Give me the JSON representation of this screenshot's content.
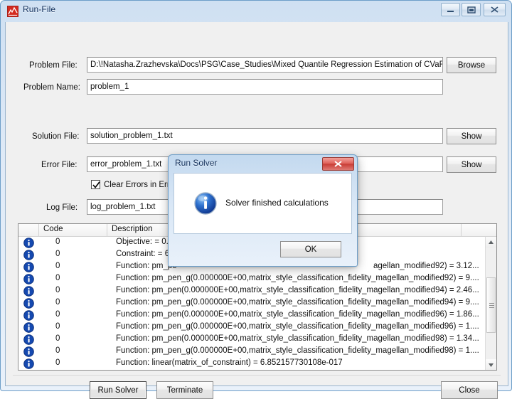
{
  "window": {
    "title": "Run-File",
    "icon": "chart-app-icon",
    "controls": {
      "minimize": "minimize-icon",
      "maximize": "maximize-icon",
      "close": "close-icon"
    }
  },
  "form": {
    "problem_file": {
      "label": "Problem File:",
      "value": "D:\\!Natasha.Zrazhevska\\Docs\\PSG\\Case_Studies\\Mixed Quantile Regression Estimation of CVaR with",
      "button": "Browse"
    },
    "problem_name": {
      "label": "Problem Name:",
      "value": "problem_1"
    },
    "solution_file": {
      "label": "Solution File:",
      "value": "solution_problem_1.txt",
      "button": "Show"
    },
    "error_file": {
      "label": "Error File:",
      "value": "error_problem_1.txt",
      "button": "Show"
    },
    "clear_errors_checkbox": {
      "label": "Clear Errors in Error File",
      "checked": true
    },
    "log_file": {
      "label": "Log File:",
      "value": "log_problem_1.txt"
    }
  },
  "log_table": {
    "columns": [
      "",
      "Code",
      "Description",
      ""
    ],
    "rows": [
      {
        "icon": "info-icon",
        "code": "0",
        "description": "Objective:   = 0."
      },
      {
        "icon": "info-icon",
        "code": "0",
        "description": "Constraint:  = 6."
      },
      {
        "icon": "info-icon",
        "code": "0",
        "description": "Function: pm_pe"
      },
      {
        "icon": "info-icon",
        "code": "0",
        "description": "Function: pm_pen_g(0.000000E+00,matrix_style_classification_fidelity_magellan_modified92) = 9...."
      },
      {
        "icon": "info-icon",
        "code": "0",
        "description": "Function: pm_pen(0.000000E+00,matrix_style_classification_fidelity_magellan_modified94) = 2.46..."
      },
      {
        "icon": "info-icon",
        "code": "0",
        "description": "Function: pm_pen_g(0.000000E+00,matrix_style_classification_fidelity_magellan_modified94) = 9...."
      },
      {
        "icon": "info-icon",
        "code": "0",
        "description": "Function: pm_pen(0.000000E+00,matrix_style_classification_fidelity_magellan_modified96) = 1.86..."
      },
      {
        "icon": "info-icon",
        "code": "0",
        "description": "Function: pm_pen_g(0.000000E+00,matrix_style_classification_fidelity_magellan_modified96) = 1...."
      },
      {
        "icon": "info-icon",
        "code": "0",
        "description": "Function: pm_pen(0.000000E+00,matrix_style_classification_fidelity_magellan_modified98) = 1.34..."
      },
      {
        "icon": "info-icon",
        "code": "0",
        "description": "Function: pm_pen_g(0.000000E+00,matrix_style_classification_fidelity_magellan_modified98) = 1...."
      },
      {
        "icon": "info-icon",
        "code": "0",
        "description": "Function: linear(matrix_of_constraint) = 6.852157730108e-017"
      }
    ],
    "row_partial_tail": {
      "row3_tail": "agellan_modified92) = 3.12..."
    }
  },
  "footer": {
    "run_solver": "Run Solver",
    "terminate": "Terminate",
    "close": "Close"
  },
  "dialog": {
    "title": "Run Solver",
    "message": "Solver finished calculations",
    "icon": "info-icon",
    "ok_button": "OK",
    "close_button": "close-icon"
  },
  "colors": {
    "window_frame": "#6d9ec8",
    "client_background": "#f0f0f0",
    "title_text": "#14315c",
    "info_icon": "#1549b0",
    "dialog_close_red": "#c83d36",
    "app_icon_red": "#d42b20"
  }
}
